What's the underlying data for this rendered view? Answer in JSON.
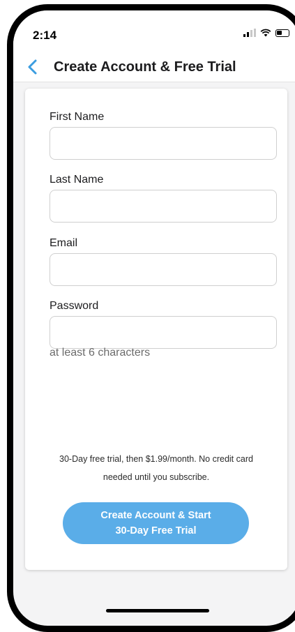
{
  "status_bar": {
    "time": "2:14"
  },
  "nav": {
    "title": "Create Account & Free Trial"
  },
  "form": {
    "fields": [
      {
        "label": "First Name",
        "value": "",
        "placeholder": ""
      },
      {
        "label": "Last Name",
        "value": "",
        "placeholder": ""
      },
      {
        "label": "Email",
        "value": "",
        "placeholder": ""
      },
      {
        "label": "Password",
        "value": "",
        "placeholder": ""
      }
    ],
    "password_hint": "at least 6 characters"
  },
  "footer": {
    "disclaimer_line1": "30-Day free trial, then $1.99/month. No credit card",
    "disclaimer_line2": "needed until you subscribe.",
    "cta_line1": "Create Account & Start",
    "cta_line2": "30-Day Free Trial"
  },
  "colors": {
    "accent": "#5aade8",
    "back_chevron": "#3b9de0",
    "background": "#f4f4f5"
  }
}
